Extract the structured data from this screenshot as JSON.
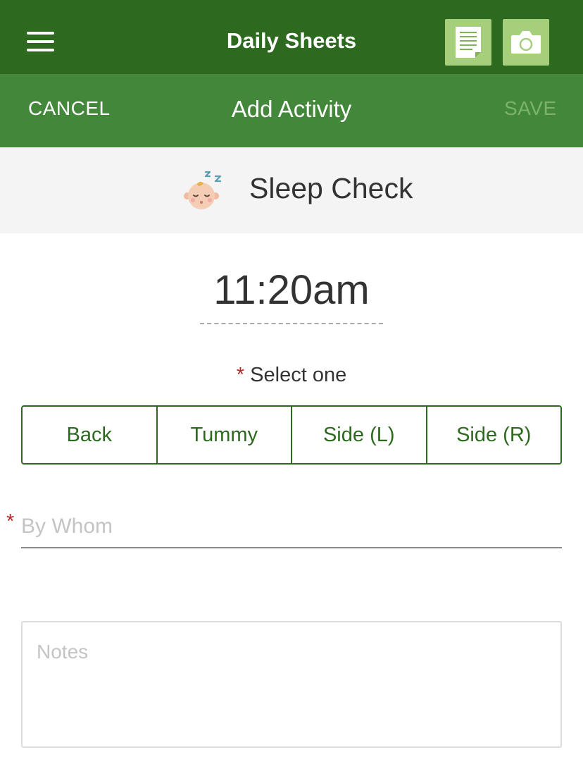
{
  "app_bar": {
    "title": "Daily Sheets",
    "menu_icon": "hamburger-menu-icon",
    "notes_icon": "notes-document-icon",
    "camera_icon": "camera-icon",
    "color": "#2d6a1f",
    "tool_button_color": "#a6cf7c"
  },
  "sub_bar": {
    "cancel_label": "CANCEL",
    "title": "Add Activity",
    "save_label": "SAVE",
    "color": "#42873a"
  },
  "activity": {
    "icon": "sleeping-baby-icon",
    "name": "Sleep Check"
  },
  "time": {
    "value": "11:20am"
  },
  "position_select": {
    "required_mark": "*",
    "label": "Select one",
    "options": [
      "Back",
      "Tummy",
      "Side (L)",
      "Side (R)"
    ]
  },
  "by_whom": {
    "required_mark": "*",
    "placeholder": "By Whom",
    "value": ""
  },
  "notes": {
    "placeholder": "Notes",
    "value": ""
  }
}
